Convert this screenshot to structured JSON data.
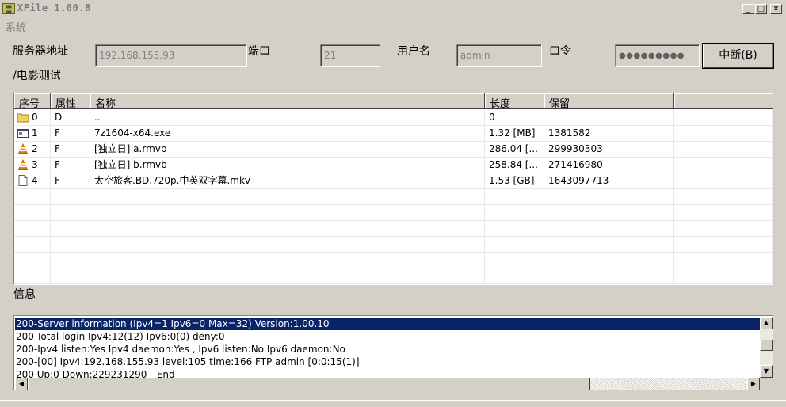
{
  "window": {
    "title": "XFile 1.00.8",
    "icon": "app-icon",
    "controls": [
      "minimize",
      "maximize",
      "close"
    ]
  },
  "menu": {
    "system": "系统"
  },
  "connection": {
    "server_label": "服务器地址",
    "server_value": "192.168.155.93",
    "port_label": "端口",
    "port_value": "21",
    "user_label": "用户名",
    "user_value": "admin",
    "password_label": "口令",
    "password_value": "●●●●●●●●●",
    "disconnect_label": "中断(B)",
    "current_path": "/电影测试"
  },
  "file_list": {
    "headers": [
      "序号",
      "属性",
      "名称",
      "长度",
      "保留"
    ],
    "rows": [
      {
        "icon": "folder-icon",
        "index": "0",
        "attr": "D",
        "name": "..",
        "length": "0",
        "reserved": ""
      },
      {
        "icon": "exe-icon",
        "index": "1",
        "attr": "F",
        "name": "7z1604-x64.exe",
        "length": "1.32 [MB]",
        "reserved": "1381582"
      },
      {
        "icon": "vlc-icon",
        "index": "2",
        "attr": "F",
        "name": "[独立日] a.rmvb",
        "length": "286.04 [...",
        "reserved": "299930303"
      },
      {
        "icon": "vlc-icon",
        "index": "3",
        "attr": "F",
        "name": "[独立日] b.rmvb",
        "length": "258.84 [...",
        "reserved": "271416980"
      },
      {
        "icon": "file-icon",
        "index": "4",
        "attr": "F",
        "name": "太空旅客.BD.720p.中英双字幕.mkv",
        "length": "1.53 [GB]",
        "reserved": "1643097713"
      }
    ]
  },
  "log": {
    "label": "信息",
    "lines": [
      "200-Server information (Ipv4=1 Ipv6=0 Max=32) Version:1.00.10",
      "200-Total login  Ipv4:12(12) Ipv6:0(0) deny:0",
      "200-Ipv4 listen:Yes Ipv4 daemon:Yes , Ipv6 listen:No Ipv6 daemon:No",
      "200-[00] Ipv4:192.168.155.93 level:105 time:166 FTP admin [0:0:15(1)]",
      "200 Up:0 Down:229231290 --End"
    ],
    "selected_index": 0
  },
  "colors": {
    "selection": "#0a246a",
    "face": "#d4d0c8"
  }
}
